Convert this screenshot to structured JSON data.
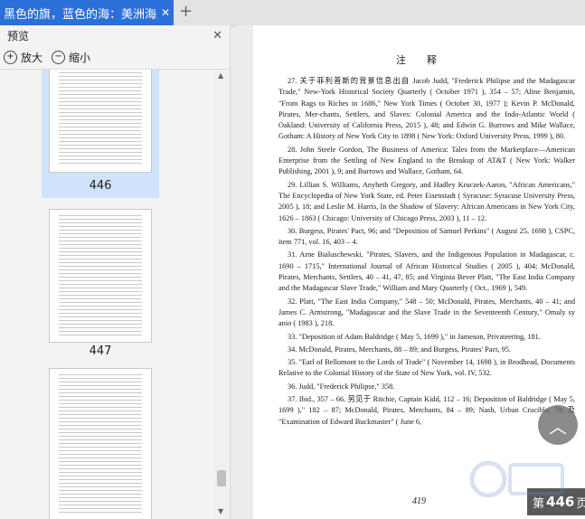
{
  "tab": {
    "title": "黑色的旗，蓝色的海：美洲海盗",
    "close": "✕",
    "add": "+"
  },
  "panel": {
    "title": "预览",
    "close": "✕",
    "zoom_in": "放大",
    "zoom_out": "缩小",
    "thumbnails": [
      {
        "page": "446",
        "selected": true
      },
      {
        "page": "447",
        "selected": false
      },
      {
        "page": "",
        "selected": false
      }
    ]
  },
  "document": {
    "heading": "注　释",
    "page_number": "419",
    "notes": [
      "27. 关于菲利普斯的背景信息出自 Jacob Judd, \"Frederick Philipse and the Madagascar Trade,\" New-York Historical Society Quarterly ( October 1971 ), 354 – 57; Aline Benjamin, \"From Rags to Riches in 1686,\" New York Times ( October 30, 1977 ); Kevin P. McDonald, Pirates, Mer-chants, Settlers, and Slaves: Colonial America and the Indo-Atlantic World ( Oakland: University of California Press, 2015 ), 48; and Edwin G. Burrows and Mike Wallace, Gotham: A History of New York City to 1898 ( New York: Oxford University Press, 1999 ), 80.",
      "28. John Steele Gordon, The Business of America: Tales from the Marketplace—American Enterprise from the Settling of New England to the Breakup of AT&T ( New York: Walker Publishing, 2001 ), 9; and Burrows and Wallace, Gotham, 64.",
      "29. Lillian S. Williams, Anyheth Gregory, and Hadley Kruczek-Aaron, \"African Americans,\" The Encyclopedia of New York State, ed. Peter Eisenstadt ( Syracuse: Syracuse University Press, 2005 ), 18; and Leslie M. Harris, In the Shadow of Slavery: African Americans in New York City, 1626 – 1863 ( Chicago: University of Chicago Press, 2003 ), 11 – 12.",
      "30. Burgess, Pirates' Pact, 96; and \"Deposition of Samuel Perkins\" ( August 25, 1698 ), CSPC, item 771, vol. 16, 403 – 4.",
      "31. Arne Bialuschewski, \"Pirates, Slavers, and the Indigenous Population in Madagascar, c. 1690 – 1715,\" International Journal of African Historical Studies ( 2005 ), 404; McDonald, Pirates, Merchants, Settlers, 40 – 41, 47, 85; and Virginia Bever Platt, \"The East India Company and the Madagascar Slave Trade,\" William and Mary Quarterly ( Oct., 1969 ), 549.",
      "32. Platt, \"The East India Company,\" 548 – 50; McDonald, Pirates, Merchants, 40 – 41; and James C. Armstrong, \"Madagascar and the Slave Trade in the Seventeenth Century,\" Omaly sy anio ( 1983 ), 218.",
      "33. \"Deposition of Adam Baldridge ( May 5, 1699 ),\" in Jameson, Privateering, 181.",
      "34. McDonald, Pirates, Merchants, 88 – 89; and Burgess, Pirates' Pact, 95.",
      "35. \"Earl of Bellomont to the Lords of Trade\" ( November 14, 1698 ), in Brodhead, Documents Relative to the Colonial History of the State of New York, vol. IV, 532.",
      "36. Judd, \"Frederick Philipse,\" 358.",
      "37. Ibid., 357 – 66. 另见于 Ritchie, Captain Kidd, 112 – 16; Deposition of Baldridge ( May 5, 1699 ),\" 182 – 87; McDonald, Pirates, Merchants, 84 – 89; Nash, Urban Crucible, 70; 及 \"Examination of Edward Buckmaster\" ( June 6,"
    ]
  },
  "floating": {
    "up_icon": "︿",
    "page_label_prefix": "第",
    "page_label_num": "446",
    "page_label_suffix": "页"
  },
  "colors": {
    "tab_active": "#2b6fd8",
    "selected_thumb": "#cfe3fb"
  }
}
